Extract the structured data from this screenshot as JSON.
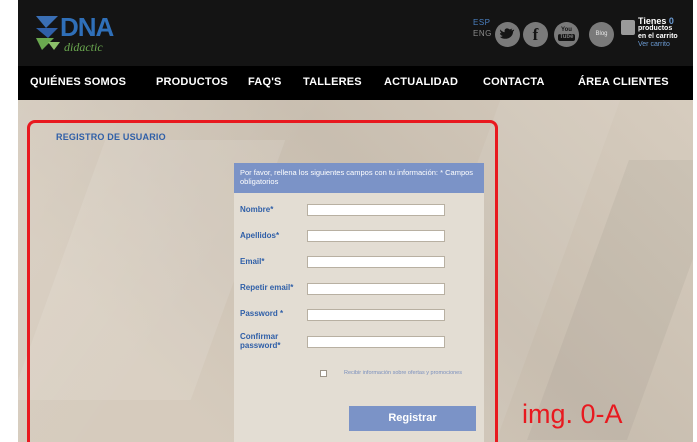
{
  "header": {
    "logo": {
      "name": "DNA",
      "subtitle": "didactic"
    },
    "languages": [
      "ESP",
      "ENG"
    ],
    "social": [
      {
        "name": "twitter",
        "icon": "twitter-icon"
      },
      {
        "name": "facebook",
        "icon": "facebook-icon"
      },
      {
        "name": "youtube",
        "icon": "youtube-icon",
        "label_top": "You",
        "label_bottom": "Tube"
      }
    ],
    "blog_label": "Blog",
    "cart": {
      "line1": "Tienes",
      "count": "0",
      "line2": "productos",
      "line3": "en el carrito",
      "link": "Ver carrito"
    }
  },
  "nav": {
    "items": [
      "QUIÉNES SOMOS",
      "PRODUCTOS",
      "FAQ'S",
      "TALLERES",
      "ACTUALIDAD",
      "CONTACTA",
      "ÁREA CLIENTES"
    ]
  },
  "page": {
    "title": "REGISTRO DE USUARIO"
  },
  "form": {
    "intro": "Por favor, rellena los siguientes campos con tu información: * Campos obligatorios",
    "fields": [
      {
        "label": "Nombre*",
        "value": ""
      },
      {
        "label": "Apellidos*",
        "value": ""
      },
      {
        "label": "Email*",
        "value": ""
      },
      {
        "label": "Repetir email*",
        "value": ""
      },
      {
        "label": "Password *",
        "value": ""
      },
      {
        "label_line1": "Confirmar",
        "label_line2": "password*",
        "value": ""
      }
    ],
    "newsletter_label": "Recibir información sobre ofertas y promociones",
    "newsletter_checked": false,
    "submit_label": "Registrar"
  },
  "annotation": {
    "label": "img. 0-A",
    "color": "#e8191f"
  },
  "colors": {
    "header_bg": "#141414",
    "nav_bg": "#000000",
    "accent": "#7b93c7",
    "link_blue": "#2f5fa8"
  }
}
